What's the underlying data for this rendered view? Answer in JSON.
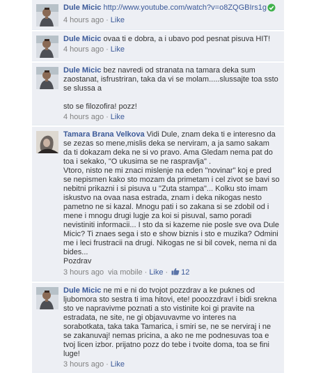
{
  "comments": [
    {
      "author": "Dule Micic",
      "link": "http://www.youtube.com/watch?v=o8ZQGBIrs1g",
      "text": "",
      "time": "4 hours ago",
      "like": "Like"
    },
    {
      "author": "Dule Micic",
      "text": "ovaa ti e dobra, a i ubavo pod pesnat pisuva HIT!",
      "time": "4 hours ago",
      "like": "Like"
    },
    {
      "author": "Dule Micic",
      "text": "bez navredi od stranata na tamara deka sum zaostanat, isfrustriran, taka da vi se molam.....slussajte toa ssto se slussa a\n\nsto se filozofira! pozz!",
      "time": "4 hours ago",
      "like": "Like"
    },
    {
      "author": "Tamara Brana Velkova",
      "text": "Vidi Dule, znam deka ti e interesno da se zezas so mene,mislis deka se nerviram, a ja samo sakam da ti dokazam deka ne si vo pravo. Ama Gledam nema pat do toa i sekako, \"O ukusima se ne raspravlja\" .\nVtoro, nisto ne mi znaci mislenje na eden \"novinar\" koj e pred se nepismen kako sto mozam da primetam i cel zivot se bavi so nebitni prikazni i si pisuva u \"Zuta stampa\"... Kolku sto imam iskustvo na ovaa nasa estrada, znam i deka nikogas nesto pametno ne si kazal. Mnogu pati i so zakana si se zdobil od i mene i mnogu drugi lugje za koi si pisuval, samo poradi nevistiniti informacii... I sto da si kazeme nie posle sve ova Dule Micic? Ti znaes sega i sto e show biznis i sto e muzika? Odmini me i leci frustracii na drugi. Nikogas ne si bil covek, nema ni da bides...\nPozdrav",
      "time": "3 hours ago",
      "via": "via mobile",
      "like": "Like",
      "likes": "12"
    },
    {
      "author": "Dule Micic",
      "text": "ne mi e ni do tvojot pozzdrav a ke puknes od ljubomora sto sestra ti ima hitovi, ete! pooozzdrav! i bidi srekna sto ve napravivme poznati a sto vistinite koi gi pravite na estradata, ne site, ne gi objavuvavme vo interes na sorabotkata, taka taka Tamarica, i smiri se, ne se nerviraj i ne se zakanuvaj! nemas pricina, a ako ne me podnesuvas toa e tvoj licen izbor. prijatno pozz do tebe i tvoite doma, toa se fini luge!",
      "time": "3 hours ago",
      "like": "Like"
    }
  ],
  "colors": {
    "comment_bg": "#edeff4",
    "author": "#3b5998",
    "meta": "#808080",
    "check": "#3fb24b"
  },
  "icons": {
    "check": "check-circle-icon",
    "like": "thumbs-up-icon"
  }
}
